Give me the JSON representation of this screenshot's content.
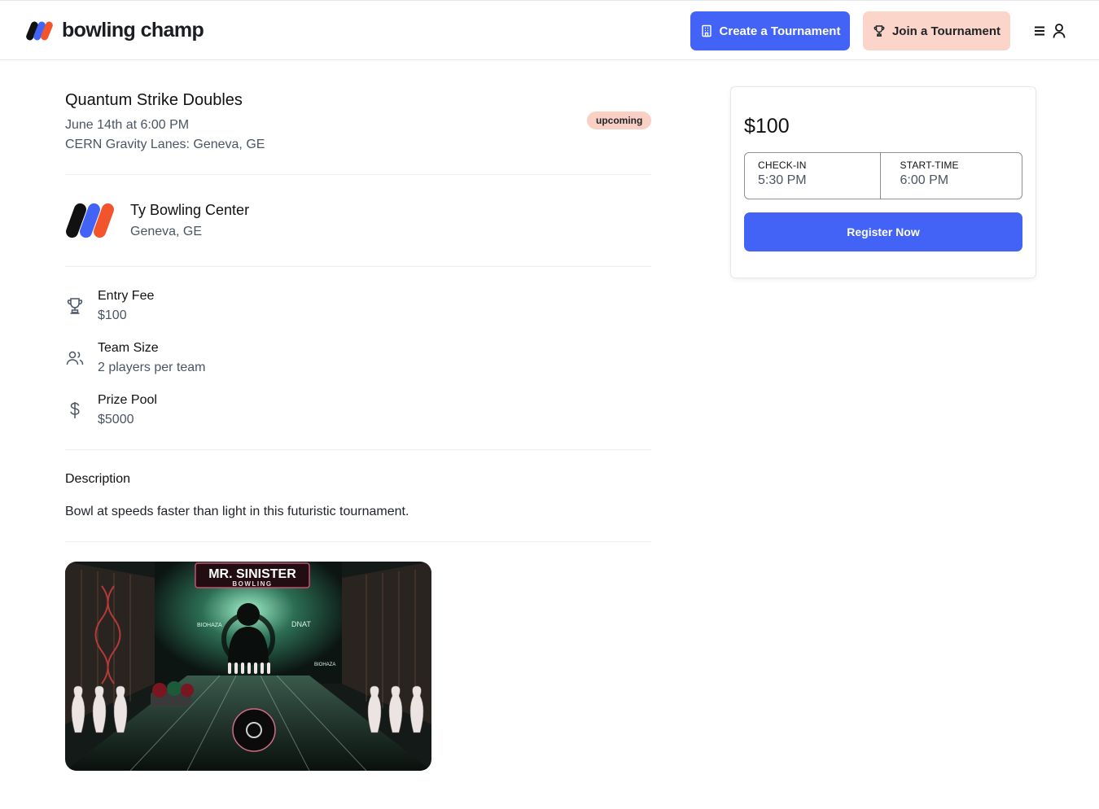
{
  "header": {
    "brand_name": "bowling champ",
    "create_label": "Create a Tournament",
    "join_label": "Join a Tournament",
    "icons": [
      "brand-logo-icon",
      "building-icon",
      "trophy-icon",
      "menu-icon",
      "user-icon"
    ]
  },
  "tournament": {
    "title": "Quantum Strike Doubles",
    "date": "June 14th at 6:00 PM",
    "location": "CERN Gravity Lanes: Geneva, GE",
    "status": "upcoming"
  },
  "center": {
    "name": "Ty Bowling Center",
    "location": "Geneva, GE"
  },
  "details": [
    {
      "icon": "trophy-icon",
      "label": "Entry Fee",
      "value": "$100"
    },
    {
      "icon": "users-icon",
      "label": "Team Size",
      "value": "2 players per team"
    },
    {
      "icon": "dollar-icon",
      "label": "Prize Pool",
      "value": "$5000"
    }
  ],
  "description": {
    "heading": "Description",
    "text": "Bowl at speeds faster than light in this futuristic tournament."
  },
  "poster": {
    "title_line1": "MR. SINISTER",
    "title_line2": "BOWLING",
    "tag_left": "BIOHAZA",
    "tag_right": "DNAT",
    "tag_bottom": "BIOHAZA"
  },
  "registration": {
    "price": "$100",
    "checkin_label": "CHECK-IN",
    "checkin_value": "5:30 PM",
    "start_label": "START-TIME",
    "start_value": "6:00 PM",
    "register_label": "Register Now"
  },
  "colors": {
    "primary": "#4263f5",
    "accent_peach": "#fbd5c9",
    "logo_black": "#111111",
    "logo_blue": "#4263f5",
    "logo_orange": "#f2552c"
  }
}
